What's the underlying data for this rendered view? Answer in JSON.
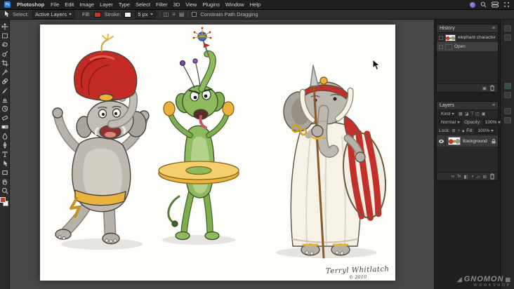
{
  "menubar": {
    "app_name": "Photoshop",
    "items": [
      "File",
      "Edit",
      "Image",
      "Layer",
      "Type",
      "Select",
      "Filter",
      "3D",
      "View",
      "Plugins",
      "Window",
      "Help"
    ],
    "right_icons": [
      "siri-icon",
      "search-icon",
      "control-center-icon",
      "switcher-icon"
    ]
  },
  "options": {
    "select_label": "Select:",
    "select_value": "Active Layers",
    "fill_label": "Fill:",
    "fill_color": "#c0392b",
    "stroke_label": "Stroke:",
    "stroke_width": "5 px",
    "constrain_label": "Constrain Path Dragging"
  },
  "toolbar": {
    "tools": [
      "move",
      "rectangular-marquee",
      "lasso",
      "quick-selection",
      "crop",
      "eyedropper",
      "spot-healing",
      "brush",
      "clone-stamp",
      "history-brush",
      "eraser",
      "gradient",
      "blur",
      "pen",
      "type",
      "path-selection",
      "rectangle-shape",
      "hand",
      "zoom"
    ],
    "foreground_color": "#c0392b",
    "background_color": "#ffffff"
  },
  "history": {
    "title": "History",
    "items": [
      {
        "label": "elephant characters.jpeg"
      },
      {
        "label": "Open"
      }
    ]
  },
  "layers": {
    "title": "Layers",
    "kind_label": "Kind",
    "blend_mode": "Normal",
    "opacity_label": "Opacity:",
    "opacity_value": "100%",
    "lock_label": "Lock:",
    "fill_label": "Fill:",
    "fill_value": "100%",
    "rows": [
      {
        "name": "Background"
      }
    ]
  },
  "canvas": {
    "signature": "Terryl Whitlatch",
    "signature_year": "© 2010"
  },
  "watermark": {
    "line1": "GNOMON",
    "line2": "WORKSHOP"
  },
  "colors": {
    "accent_red": "#c0392b",
    "gold": "#e9b33b",
    "green": "#8cba5c",
    "panel_bg": "#282828",
    "canvas_bg": "#474747"
  }
}
